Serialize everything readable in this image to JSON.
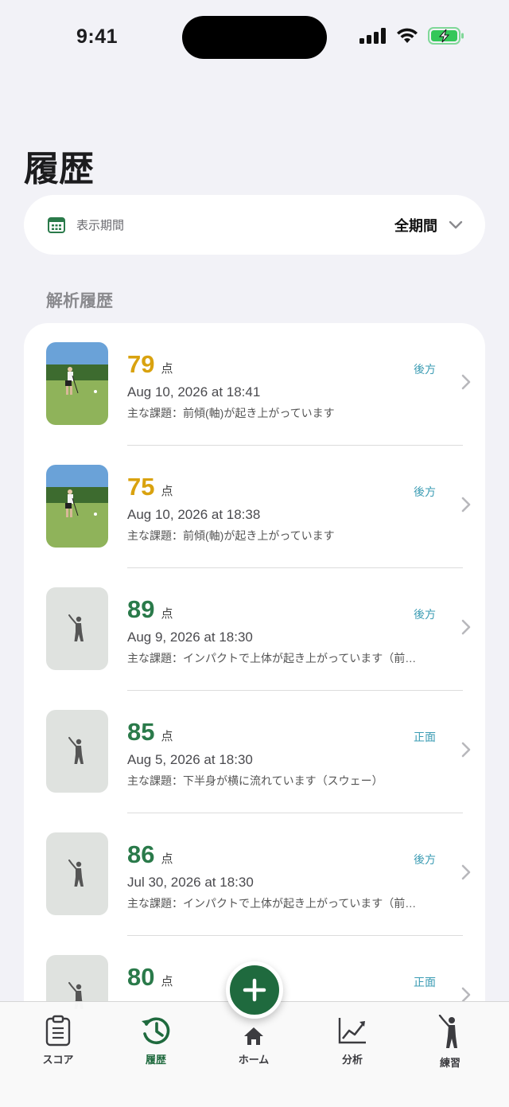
{
  "status": {
    "time": "9:41"
  },
  "header": {
    "title": "履歴"
  },
  "period": {
    "label": "表示期間",
    "value": "全期間"
  },
  "section": {
    "title": "解析履歴"
  },
  "history": [
    {
      "score": "79",
      "unit": "点",
      "date": "Aug 10, 2026 at 18:41",
      "issue": "主な課題：前傾(軸)が起き上がっています",
      "view": "後方",
      "color": "#d9a20f",
      "thumb": "photo"
    },
    {
      "score": "75",
      "unit": "点",
      "date": "Aug 10, 2026 at 18:38",
      "issue": "主な課題：前傾(軸)が起き上がっています",
      "view": "後方",
      "color": "#d9a20f",
      "thumb": "photo"
    },
    {
      "score": "89",
      "unit": "点",
      "date": "Aug 9, 2026 at 18:30",
      "issue": "主な課題：インパクトで上体が起き上がっています（前…",
      "view": "後方",
      "color": "#2a7a4a",
      "thumb": "placeholder"
    },
    {
      "score": "85",
      "unit": "点",
      "date": "Aug 5, 2026 at 18:30",
      "issue": "主な課題：下半身が横に流れています（スウェー）",
      "view": "正面",
      "color": "#2a7a4a",
      "thumb": "placeholder"
    },
    {
      "score": "86",
      "unit": "点",
      "date": "Jul 30, 2026 at 18:30",
      "issue": "主な課題：インパクトで上体が起き上がっています（前…",
      "view": "後方",
      "color": "#2a7a4a",
      "thumb": "placeholder"
    },
    {
      "score": "80",
      "unit": "点",
      "date": "",
      "issue": "",
      "view": "正面",
      "color": "#2a7a4a",
      "thumb": "placeholder"
    }
  ],
  "tabs": [
    {
      "label": "スコア",
      "icon": "clipboard-icon"
    },
    {
      "label": "履歴",
      "icon": "history-icon",
      "active": true
    },
    {
      "label": "ホーム",
      "icon": "home-icon"
    },
    {
      "label": "分析",
      "icon": "chart-icon"
    },
    {
      "label": "練習",
      "icon": "golfer-icon"
    }
  ],
  "colors": {
    "accent": "#1f6a3e",
    "score_high": "#2a7a4a",
    "score_mid": "#d9a20f",
    "view_label": "#3a9bb3"
  }
}
